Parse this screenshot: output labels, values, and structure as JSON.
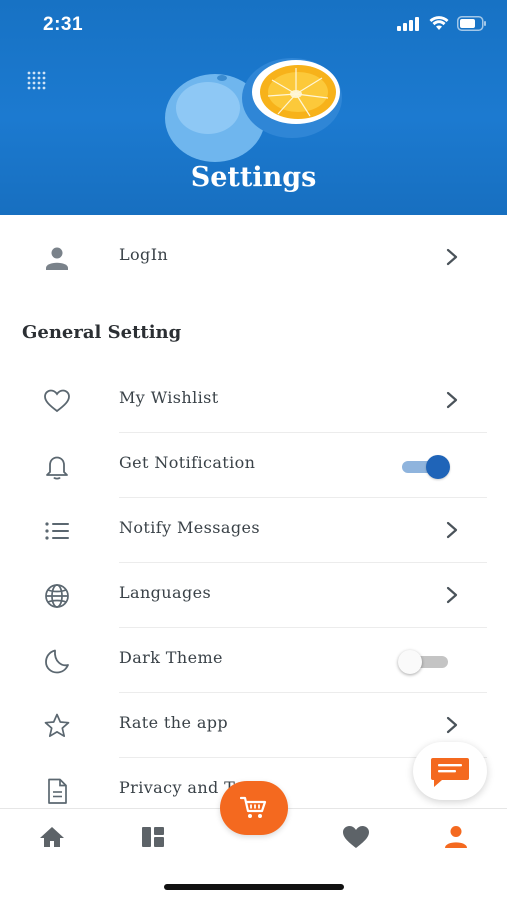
{
  "status_bar": {
    "time": "2:31"
  },
  "header": {
    "title": "Settings"
  },
  "login": {
    "label": "LogIn"
  },
  "general": {
    "section_title": "General Setting",
    "items": [
      {
        "label": "My Wishlist",
        "icon": "heart-outline-icon",
        "control": "chevron"
      },
      {
        "label": "Get Notification",
        "icon": "bell-icon",
        "control": "toggle",
        "toggle_on": true
      },
      {
        "label": "Notify Messages",
        "icon": "list-icon",
        "control": "chevron"
      },
      {
        "label": "Languages",
        "icon": "globe-icon",
        "control": "chevron"
      },
      {
        "label": "Dark Theme",
        "icon": "moon-icon",
        "control": "toggle",
        "toggle_on": false
      },
      {
        "label": "Rate the app",
        "icon": "star-icon",
        "control": "chevron"
      },
      {
        "label": "Privacy and T",
        "icon": "document-icon",
        "control": "none"
      }
    ]
  },
  "bottom_nav": {
    "items": [
      "home-icon",
      "dashboard-icon",
      "cart-icon",
      "heart-icon",
      "person-icon"
    ],
    "active": "person-icon"
  },
  "colors": {
    "header_blue": "#1a75c9",
    "accent_orange": "#f4691f",
    "toggle_on": "#1f64b8",
    "icon_gray": "#5b6770"
  }
}
